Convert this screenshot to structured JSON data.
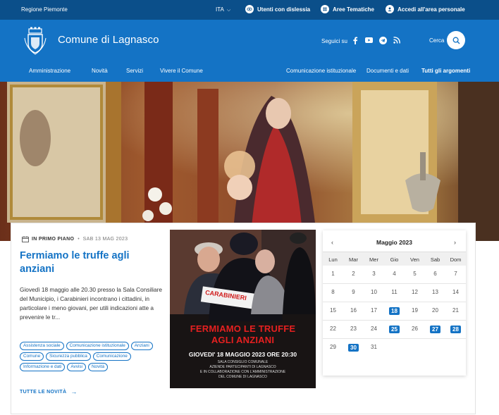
{
  "topbar": {
    "region": "Regione Piemonte",
    "language": "ITA",
    "links": [
      {
        "label": "Utenti con dislessia",
        "icon": "eye-icon"
      },
      {
        "label": "Aree Tematiche",
        "icon": "grid-icon"
      },
      {
        "label": "Accedi all'area personale",
        "icon": "user-icon"
      }
    ]
  },
  "header": {
    "title": "Comune di Lagnasco",
    "follow_label": "Seguici su",
    "social": [
      "facebook-icon",
      "youtube-icon",
      "telegram-icon",
      "rss-icon"
    ],
    "search_label": "Cerca"
  },
  "nav": {
    "primary": [
      "Amministrazione",
      "Novità",
      "Servizi",
      "Vivere il Comune"
    ],
    "secondary": [
      "Comunicazione istituzionale",
      "Documenti e dati"
    ],
    "all_topics": "Tutti gli argomenti"
  },
  "news": {
    "category": "IN PRIMO PIANO",
    "date": "SAB 13 MAG 2023",
    "title": "Fermiamo le truffe agli anziani",
    "text": "Giovedì 18 maggio alle 20.30 presso la Sala Consiliare del Municipio, i Carabinieri incontrano i cittadini, in particolare i meno giovani, per utili indicazioni atte a prevenire le tr...",
    "tags": [
      "Assistenza sociale",
      "Comunicazione istituzionale",
      "Anziani",
      "Comune",
      "Sicurezza pubblica",
      "Comunicazione",
      "Informazione e dati",
      "Avvisi",
      "Novità"
    ],
    "all_news": "TUTTE LE NOVITÀ"
  },
  "poster": {
    "badge": "CARABINIERI",
    "line1": "FERMIAMO LE TRUFFE",
    "line2": "AGLI ANZIANI",
    "line3": "GIOVEDI' 18 MAGGIO 2023 ORE 20:30",
    "line4": "SALA CONSIGLIO COMUNALE",
    "line5": "AZIENDE PARTECIPANTI DI LAGNASCO",
    "line6": "E IN COLLABORAZIONE CON L'AMMINISTRAZIONE",
    "line7": "DEL COMUNE DI LAGNASCO"
  },
  "calendar": {
    "month": "Maggio 2023",
    "prev": "‹",
    "next": "›",
    "weekdays": [
      "Lun",
      "Mar",
      "Mer",
      "Gio",
      "Ven",
      "Sab",
      "Dom"
    ],
    "weeks": [
      [
        "1",
        "2",
        "3",
        "4",
        "5",
        "6",
        "7"
      ],
      [
        "8",
        "9",
        "10",
        "11",
        "12",
        "13",
        "14"
      ],
      [
        "15",
        "16",
        "17",
        "18",
        "19",
        "20",
        "21"
      ],
      [
        "22",
        "23",
        "24",
        "25",
        "26",
        "27",
        "28"
      ],
      [
        "29",
        "30",
        "31",
        "",
        "",
        "",
        ""
      ]
    ],
    "event_days": [
      "18",
      "25",
      "27",
      "28",
      "30"
    ],
    "accent": "#1473c5"
  },
  "colors": {
    "topbar": "#0b4f8a",
    "header": "#1473c5",
    "poster_text": "#e52020"
  }
}
